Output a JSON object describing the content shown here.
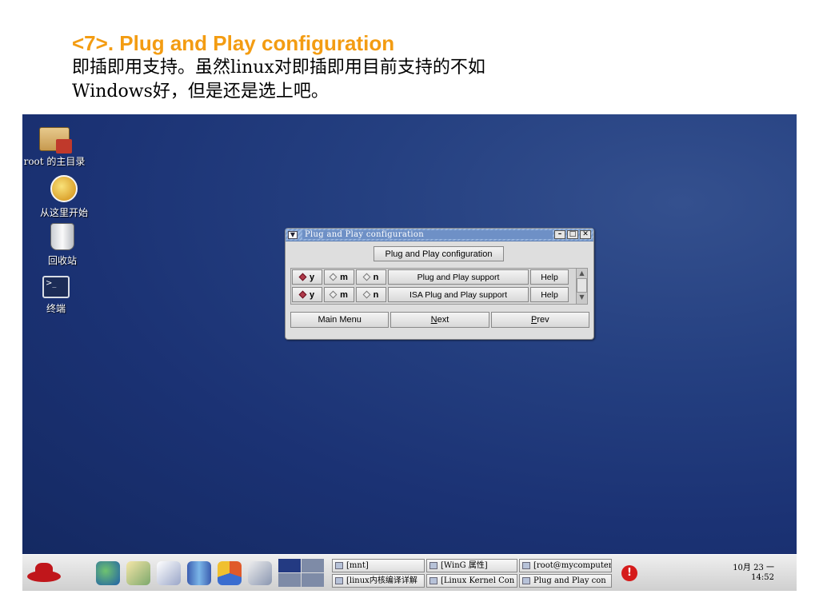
{
  "slide": {
    "title": "<7>. Plug and Play configuration",
    "text": "即插即用支持。虽然linux对即插即用目前支持的不如\nWindows好，但是还是选上吧。"
  },
  "desktop": {
    "icons": [
      {
        "label": "root 的主目录",
        "icon": "home-folder-icon"
      },
      {
        "label": "从这里开始",
        "icon": "start-here-icon"
      },
      {
        "label": "回收站",
        "icon": "trash-icon"
      },
      {
        "label": "终端",
        "icon": "terminal-icon"
      }
    ]
  },
  "window": {
    "title": "Plug and Play configuration",
    "header_button": "Plug and Play configuration",
    "options": [
      {
        "y": "y",
        "m": "m",
        "n": "n",
        "label": "Plug and Play support",
        "help": "Help",
        "selected": "y"
      },
      {
        "y": "y",
        "m": "m",
        "n": "n",
        "label": "ISA Plug and Play support",
        "help": "Help",
        "selected": "y"
      }
    ],
    "nav": {
      "main_menu": "Main Menu",
      "next_first": "N",
      "next_rest": "ext",
      "prev_first": "P",
      "prev_rest": "rev"
    }
  },
  "taskbar": {
    "tasks": [
      "[mnt]",
      "[WinG 属性]",
      "[root@mycomputer:/",
      "[linux内核编译详解",
      "[Linux Kernel Con",
      "Plug and Play con"
    ],
    "clock": {
      "date": "10月 23 一",
      "time": "14:52"
    },
    "colors": {
      "accent": "#233a82",
      "alert": "#d51b1b"
    }
  }
}
